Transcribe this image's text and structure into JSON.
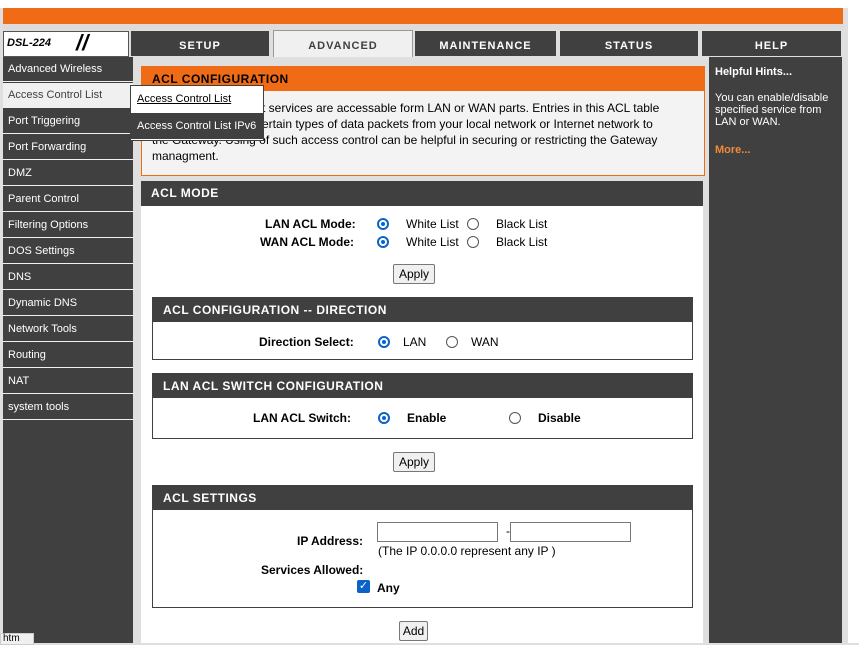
{
  "logo": {
    "model": "DSL-224"
  },
  "tabs": [
    {
      "label": "SETUP"
    },
    {
      "label": "ADVANCED"
    },
    {
      "label": "MAINTENANCE"
    },
    {
      "label": "STATUS"
    },
    {
      "label": "HELP"
    }
  ],
  "sidebar": {
    "items": [
      {
        "label": "Advanced Wireless"
      },
      {
        "label": "Access Control List"
      },
      {
        "label": "Port Triggering"
      },
      {
        "label": "Port Forwarding"
      },
      {
        "label": "DMZ"
      },
      {
        "label": "Parent Control"
      },
      {
        "label": "Filtering Options"
      },
      {
        "label": "DOS Settings"
      },
      {
        "label": "DNS"
      },
      {
        "label": "Dynamic DNS"
      },
      {
        "label": "Network Tools"
      },
      {
        "label": "Routing"
      },
      {
        "label": "NAT"
      },
      {
        "label": "system tools"
      }
    ]
  },
  "popup": {
    "item1": "Access Control List",
    "item2": "Access Control List IPv6"
  },
  "acl_config": {
    "title": "ACL CONFIGURATION",
    "line1": "t services are accessable form LAN or WAN parts.   Entries in this ACL table",
    "line2": "ertain types of data packets from your local network or Internet network to",
    "line3": "the Gateway.   Using of such access control can be helpful in securing or restricting the Gateway",
    "line4": "managment."
  },
  "acl_mode": {
    "title": "ACL MODE",
    "lan_label": "LAN ACL Mode:",
    "wan_label": "WAN ACL Mode:",
    "white": "White List",
    "black": "Black List",
    "apply": "Apply"
  },
  "direction": {
    "title": "ACL CONFIGURATION -- DIRECTION",
    "label": "Direction Select:",
    "lan": "LAN",
    "wan": "WAN"
  },
  "switch": {
    "title": "LAN ACL SWITCH CONFIGURATION",
    "label": "LAN ACL Switch:",
    "enable": "Enable",
    "disable": "Disable",
    "apply": "Apply"
  },
  "settings": {
    "title": "ACL SETTINGS",
    "ip_label": "IP Address:",
    "ip_dash": "-",
    "ip_note": "(The IP 0.0.0.0 represent any IP )",
    "services_label": "Services Allowed:",
    "any": "Any",
    "add": "Add"
  },
  "hints": {
    "title": "Helpful Hints...",
    "text": "You can enable/disable specified service from LAN or WAN.",
    "more": "More..."
  },
  "statusbar": {
    "text": "htm"
  }
}
